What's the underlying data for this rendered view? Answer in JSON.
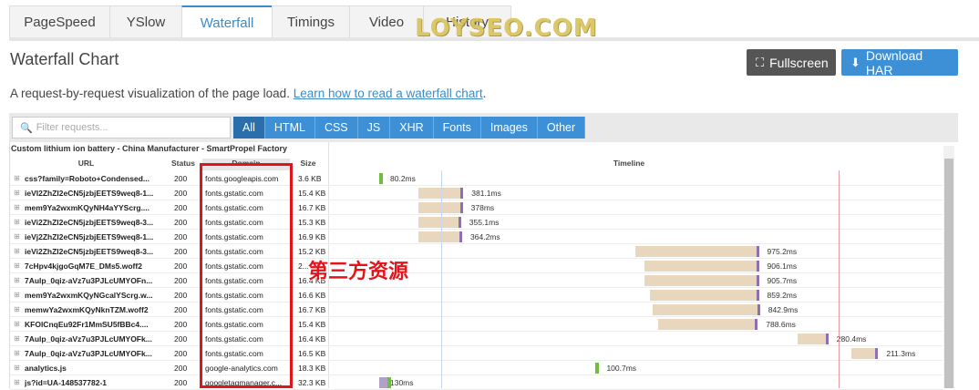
{
  "tabs": [
    {
      "label": "PageSpeed",
      "active": false
    },
    {
      "label": "YSlow",
      "active": false
    },
    {
      "label": "Waterfall",
      "active": true
    },
    {
      "label": "Timings",
      "active": false
    },
    {
      "label": "Video",
      "active": false
    },
    {
      "label": "History",
      "active": false
    }
  ],
  "watermark": "LOYSEO.COM",
  "page_title": "Waterfall Chart",
  "buttons": {
    "fullscreen": "Fullscreen",
    "download": "Download HAR"
  },
  "description": {
    "text": "A request-by-request visualization of the page load. ",
    "link": "Learn how to read a waterfall chart",
    "end": "."
  },
  "filter": {
    "placeholder": "Filter requests..."
  },
  "filter_types": [
    "All",
    "HTML",
    "CSS",
    "JS",
    "XHR",
    "Fonts",
    "Images",
    "Other"
  ],
  "site_title": "Custom lithium ion battery - China Manufacturer - SmartPropel Factory",
  "columns": {
    "url": "URL",
    "status": "Status",
    "domain": "Domain",
    "size": "Size",
    "timeline": "Timeline"
  },
  "colors": {
    "accent": "#3d8fd6",
    "annotation": "#e0141a"
  },
  "annotation": "第三方资源",
  "requests": [
    {
      "url": "css?family=Roboto+Condensed...",
      "status": "200",
      "domain": "fonts.googleapis.com",
      "size": "3.6 KB",
      "start": 0.0,
      "wait": 0.0,
      "duration": "80.2ms",
      "type": "green"
    },
    {
      "url": "ieVI2ZhZI2eCN5jzbjEETS9weq8-1...",
      "status": "200",
      "domain": "fonts.gstatic.com",
      "size": "15.4 KB",
      "start": 0.069,
      "wait": 0.075,
      "duration": "381.1ms",
      "type": "font"
    },
    {
      "url": "mem9Ya2wxmKQyNH4aYYScrg....",
      "status": "200",
      "domain": "fonts.gstatic.com",
      "size": "16.7 KB",
      "start": 0.069,
      "wait": 0.074,
      "duration": "378ms",
      "type": "font"
    },
    {
      "url": "ieVi2ZhZI2eCN5jzbjEETS9weq8-3...",
      "status": "200",
      "domain": "fonts.gstatic.com",
      "size": "15.3 KB",
      "start": 0.07,
      "wait": 0.07,
      "duration": "355.1ms",
      "type": "font"
    },
    {
      "url": "ieVj2ZhZI2eCN5jzbjEETS9weq8-1...",
      "status": "200",
      "domain": "fonts.gstatic.com",
      "size": "16.9 KB",
      "start": 0.07,
      "wait": 0.072,
      "duration": "364.2ms",
      "type": "font"
    },
    {
      "url": "ieVi2ZhZI2eCN5jzbjEETS9weq8-3...",
      "status": "200",
      "domain": "fonts.gstatic.com",
      "size": "15.2 KB",
      "start": 0.454,
      "wait": 0.213,
      "duration": "975.2ms",
      "type": "font"
    },
    {
      "url": "7cHpv4kjgoGqM7E_DMs5.woff2",
      "status": "200",
      "domain": "fonts.gstatic.com",
      "size": "2...",
      "start": 0.469,
      "wait": 0.198,
      "duration": "906.1ms",
      "type": "font"
    },
    {
      "url": "7Aulp_0qiz-aVz7u3PJLcUMYOFn...",
      "status": "200",
      "domain": "fonts.gstatic.com",
      "size": "16.4 KB",
      "start": 0.469,
      "wait": 0.198,
      "duration": "905.7ms",
      "type": "font"
    },
    {
      "url": "mem9Ya2wxmKQyNGcalYScrg.w...",
      "status": "200",
      "domain": "fonts.gstatic.com",
      "size": "16.6 KB",
      "start": 0.479,
      "wait": 0.188,
      "duration": "859.2ms",
      "type": "font"
    },
    {
      "url": "memwYa2wxmKQyNknTZM.woff2",
      "status": "200",
      "domain": "fonts.gstatic.com",
      "size": "16.7 KB",
      "start": 0.484,
      "wait": 0.185,
      "duration": "842.9ms",
      "type": "font"
    },
    {
      "url": "KFOlCnqEu92Fr1MmSU5fBBc4....",
      "status": "200",
      "domain": "fonts.gstatic.com",
      "size": "15.4 KB",
      "start": 0.493,
      "wait": 0.172,
      "duration": "788.6ms",
      "type": "font"
    },
    {
      "url": "7Aulp_0qiz-aVz7u3PJLcUMYOFk...",
      "status": "200",
      "domain": "fonts.gstatic.com",
      "size": "16.4 KB",
      "start": 0.74,
      "wait": 0.05,
      "duration": "280.4ms",
      "type": "font"
    },
    {
      "url": "7Aulp_0qiz-aVz7u3PJLcUMYOFk...",
      "status": "200",
      "domain": "fonts.gstatic.com",
      "size": "16.5 KB",
      "start": 0.836,
      "wait": 0.042,
      "duration": "211.3ms",
      "type": "font"
    },
    {
      "url": "analytics.js",
      "status": "200",
      "domain": "google-analytics.com",
      "size": "18.3 KB",
      "start": 0.383,
      "wait": 0.0,
      "duration": "100.7ms",
      "type": "green"
    },
    {
      "url": "js?id=UA-148537782-1",
      "status": "200",
      "domain": "googletagmanager.c...",
      "size": "32.3 KB",
      "start": 0.0,
      "wait": 0.0,
      "duration": "130ms",
      "type": "js"
    }
  ]
}
